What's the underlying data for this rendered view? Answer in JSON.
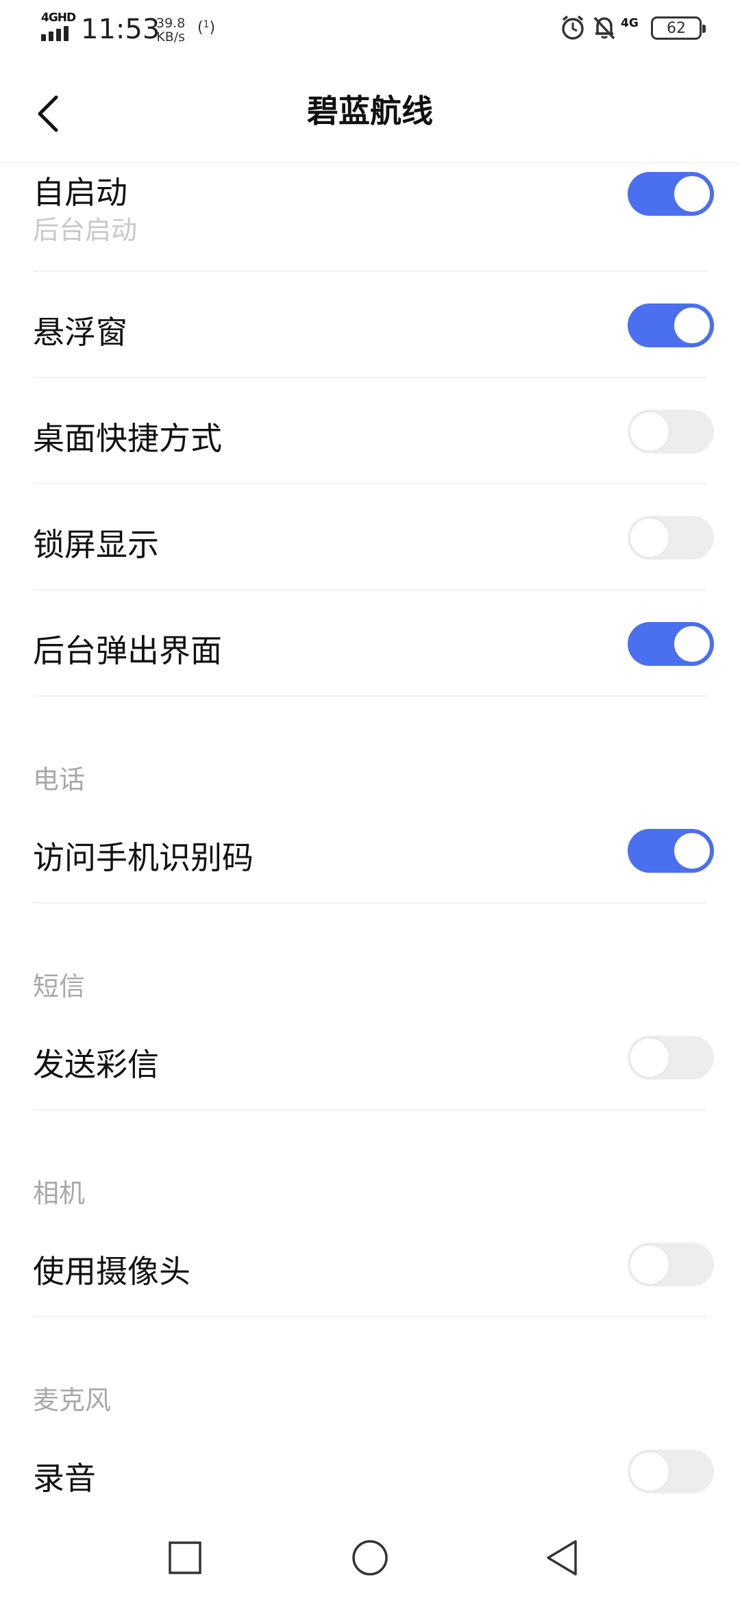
{
  "status_bar": {
    "network_type": "4GHD",
    "time": "11:53",
    "speed_value": "39.8",
    "speed_unit": "KB/s",
    "hotspot_label": "1",
    "network_4g": "4G",
    "battery": "62"
  },
  "header": {
    "title": "碧蓝航线"
  },
  "rows_main": [
    {
      "title": "自启动",
      "subtitle": "后台启动",
      "enabled": true
    },
    {
      "title": "悬浮窗",
      "enabled": true
    },
    {
      "title": "桌面快捷方式",
      "enabled": false
    },
    {
      "title": "锁屏显示",
      "enabled": false
    },
    {
      "title": "后台弹出界面",
      "enabled": true
    }
  ],
  "sections": [
    {
      "title": "电话",
      "item": {
        "title": "访问手机识别码",
        "enabled": true
      }
    },
    {
      "title": "短信",
      "item": {
        "title": "发送彩信",
        "enabled": false
      }
    },
    {
      "title": "相机",
      "item": {
        "title": "使用摄像头",
        "enabled": false
      }
    },
    {
      "title": "麦克风",
      "item": {
        "title": "录音",
        "enabled": false
      }
    }
  ],
  "colors": {
    "accent": "#4a70f0",
    "toggle_off": "#ededed",
    "section_title": "#a8a8a8"
  }
}
